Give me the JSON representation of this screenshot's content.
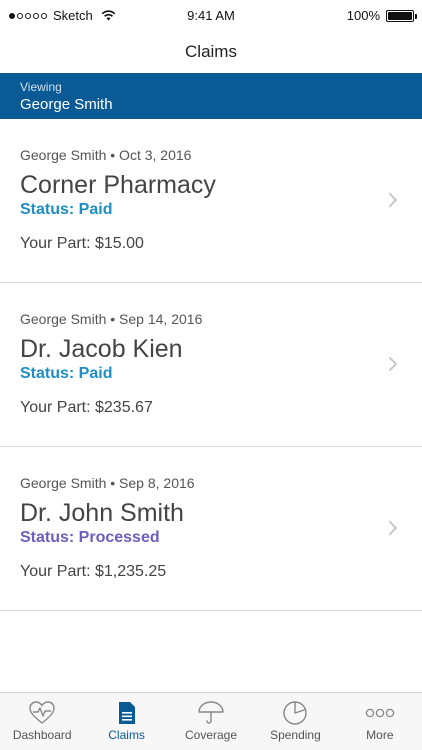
{
  "status_bar": {
    "carrier": "Sketch",
    "time": "9:41 AM",
    "battery": "100%"
  },
  "nav": {
    "title": "Claims"
  },
  "viewing": {
    "label": "Viewing",
    "name": "George Smith"
  },
  "claims": [
    {
      "meta": "George Smith •  Oct 3, 2016",
      "title": "Corner Pharmacy",
      "status": "Status: Paid",
      "your_part": "Your Part: $15.00"
    },
    {
      "meta": "George Smith • Sep 14, 2016",
      "title": "Dr. Jacob Kien",
      "status": "Status: Paid",
      "your_part": "Your Part: $235.67"
    },
    {
      "meta": "George Smith • Sep 8, 2016",
      "title": "Dr. John Smith",
      "status": "Status: Processed",
      "your_part": "Your Part: $1,235.25"
    }
  ],
  "tabs": [
    {
      "label": "Dashboard",
      "icon": "heart-pulse-icon"
    },
    {
      "label": "Claims",
      "icon": "document-icon"
    },
    {
      "label": "Coverage",
      "icon": "umbrella-icon"
    },
    {
      "label": "Spending",
      "icon": "pie-chart-icon"
    },
    {
      "label": "More",
      "icon": "more-dots-icon"
    }
  ],
  "colors": {
    "brand_blue": "#0a5a96",
    "status_paid": "#1e8fc6",
    "status_processed": "#6b5fbf"
  }
}
